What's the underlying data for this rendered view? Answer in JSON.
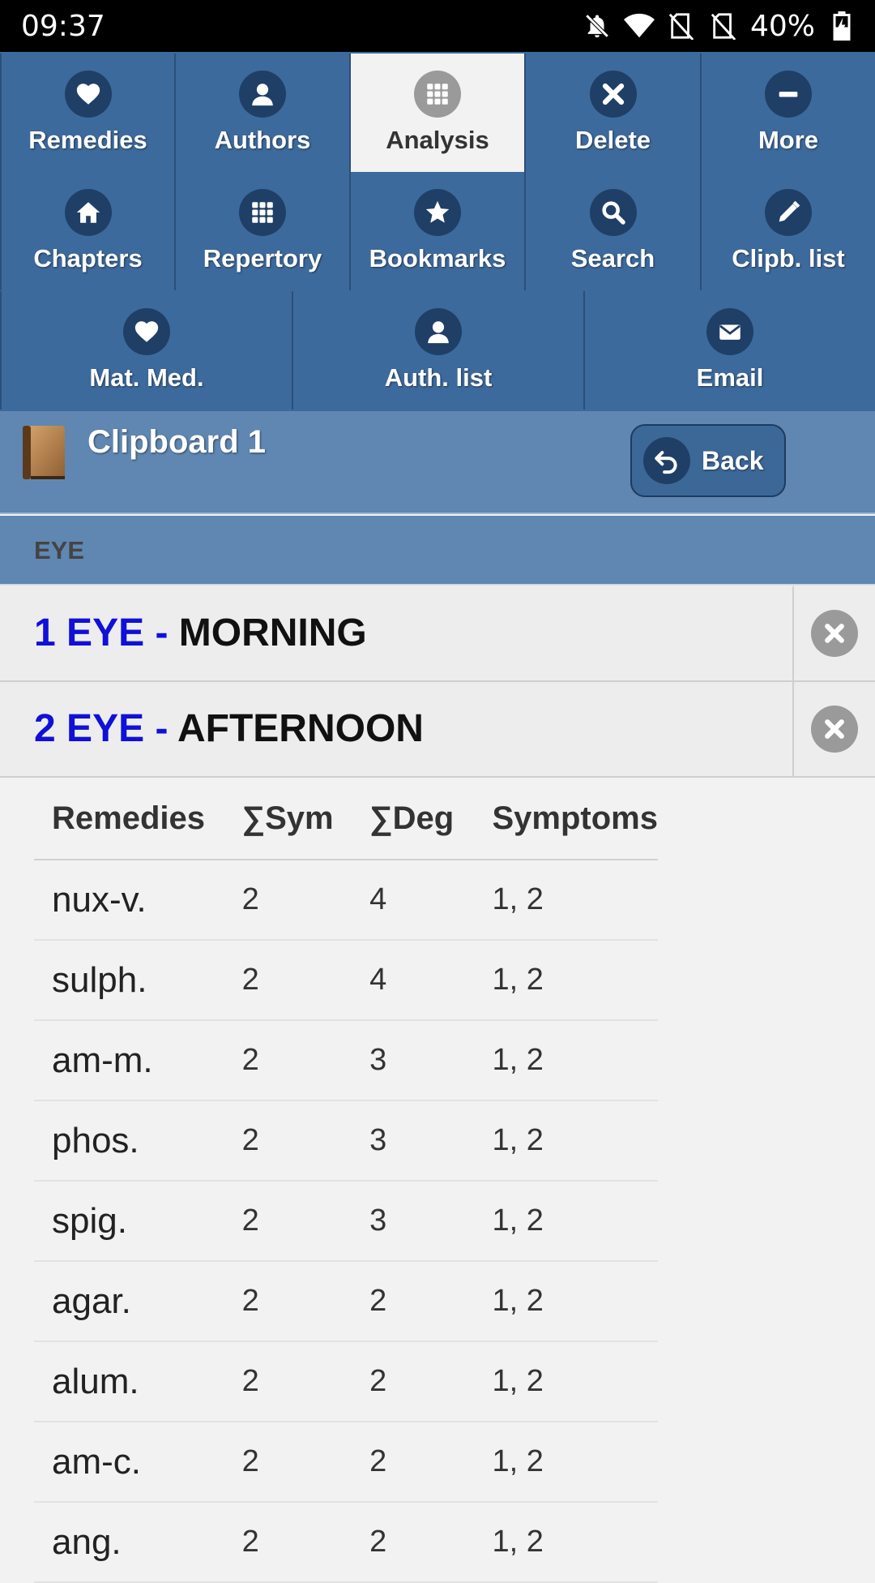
{
  "status_bar": {
    "time": "09:37",
    "battery": "40%",
    "icons": [
      "bell-off-icon",
      "wifi-icon",
      "no-sim-icon",
      "no-sim-icon",
      "battery-charging-icon"
    ]
  },
  "nav": {
    "rows": [
      [
        {
          "label": "Remedies",
          "icon": "heart-icon",
          "active": false
        },
        {
          "label": "Authors",
          "icon": "person-icon",
          "active": false
        },
        {
          "label": "Analysis",
          "icon": "grid-icon",
          "active": true
        },
        {
          "label": "Delete",
          "icon": "close-icon",
          "active": false
        },
        {
          "label": "More",
          "icon": "minus-icon",
          "active": false
        }
      ],
      [
        {
          "label": "Chapters",
          "icon": "home-icon",
          "active": false
        },
        {
          "label": "Repertory",
          "icon": "grid-icon",
          "active": false
        },
        {
          "label": "Bookmarks",
          "icon": "star-icon",
          "active": false
        },
        {
          "label": "Search",
          "icon": "search-icon",
          "active": false
        },
        {
          "label": "Clipb. list",
          "icon": "pencil-icon",
          "active": false
        }
      ],
      [
        {
          "label": "Mat. Med.",
          "icon": "heart-icon",
          "active": false
        },
        {
          "label": "Auth. list",
          "icon": "person-icon",
          "active": false
        },
        {
          "label": "Email",
          "icon": "mail-icon",
          "active": false
        }
      ]
    ]
  },
  "header": {
    "title": "Clipboard 1",
    "back_label": "Back"
  },
  "section": {
    "title": "EYE"
  },
  "symptoms": [
    {
      "number": "1",
      "chapter": "EYE",
      "dash": "-",
      "name": "MORNING"
    },
    {
      "number": "2",
      "chapter": "EYE",
      "dash": "-",
      "name": "AFTERNOON"
    }
  ],
  "table": {
    "headers": [
      "Remedies",
      "∑Sym",
      "∑Deg",
      "Symptoms"
    ],
    "rows": [
      [
        "nux-v.",
        "2",
        "4",
        "1, 2"
      ],
      [
        "sulph.",
        "2",
        "4",
        "1, 2"
      ],
      [
        "am-m.",
        "2",
        "3",
        "1, 2"
      ],
      [
        "phos.",
        "2",
        "3",
        "1, 2"
      ],
      [
        "spig.",
        "2",
        "3",
        "1, 2"
      ],
      [
        "agar.",
        "2",
        "2",
        "1, 2"
      ],
      [
        "alum.",
        "2",
        "2",
        "1, 2"
      ],
      [
        "am-c.",
        "2",
        "2",
        "1, 2"
      ],
      [
        "ang.",
        "2",
        "2",
        "1, 2"
      ]
    ]
  }
}
